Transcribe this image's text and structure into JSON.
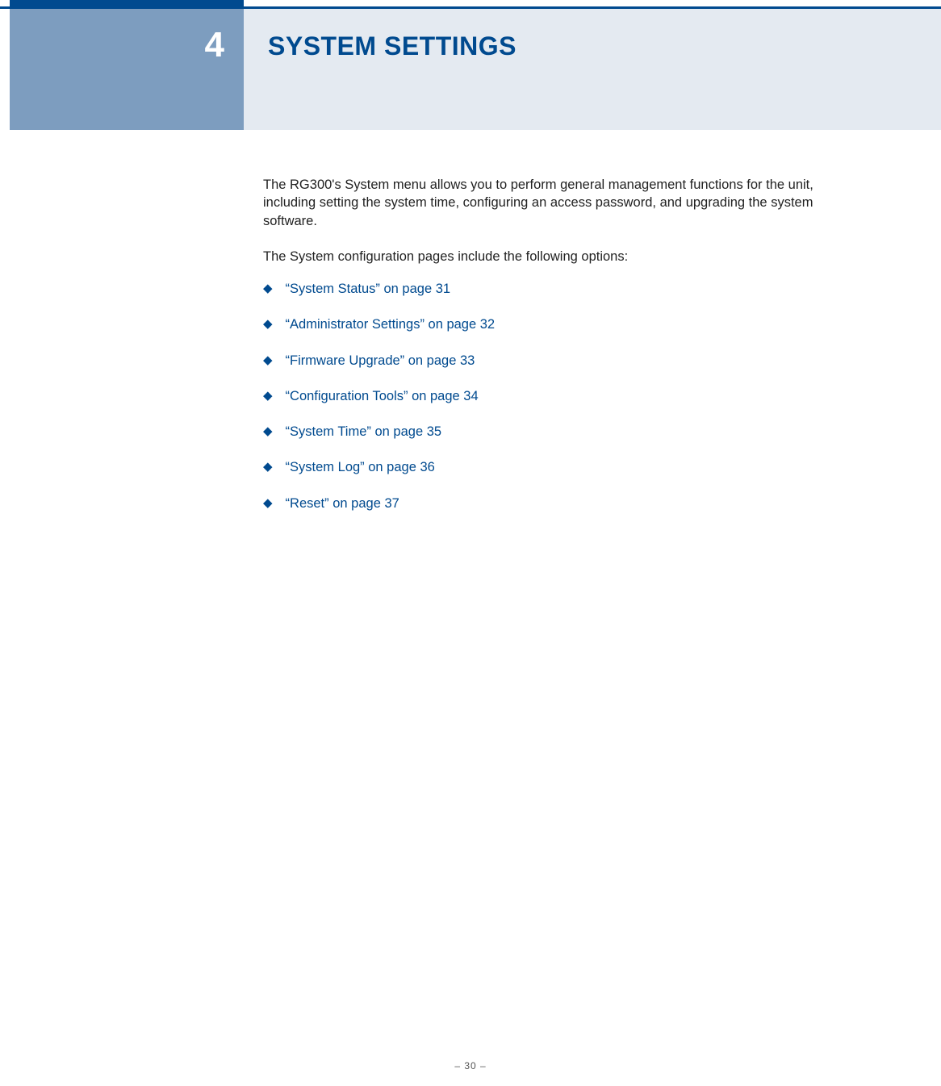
{
  "chapter": {
    "number": "4",
    "title": "SYSTEM SETTINGS"
  },
  "content": {
    "intro": "The RG300's System menu allows you to perform general management functions for the unit, including setting the system time, configuring an access password, and upgrading the system software.",
    "lead": "The System configuration pages include the following options:",
    "bullets": [
      "“System Status” on page 31",
      "“Administrator Settings” on page 32",
      "“Firmware Upgrade” on page 33",
      "“Configuration Tools” on page 34",
      "“System Time” on page 35",
      "“System Log” on page 36",
      "“Reset” on page 37"
    ]
  },
  "footer": {
    "page": "–  30  –"
  }
}
